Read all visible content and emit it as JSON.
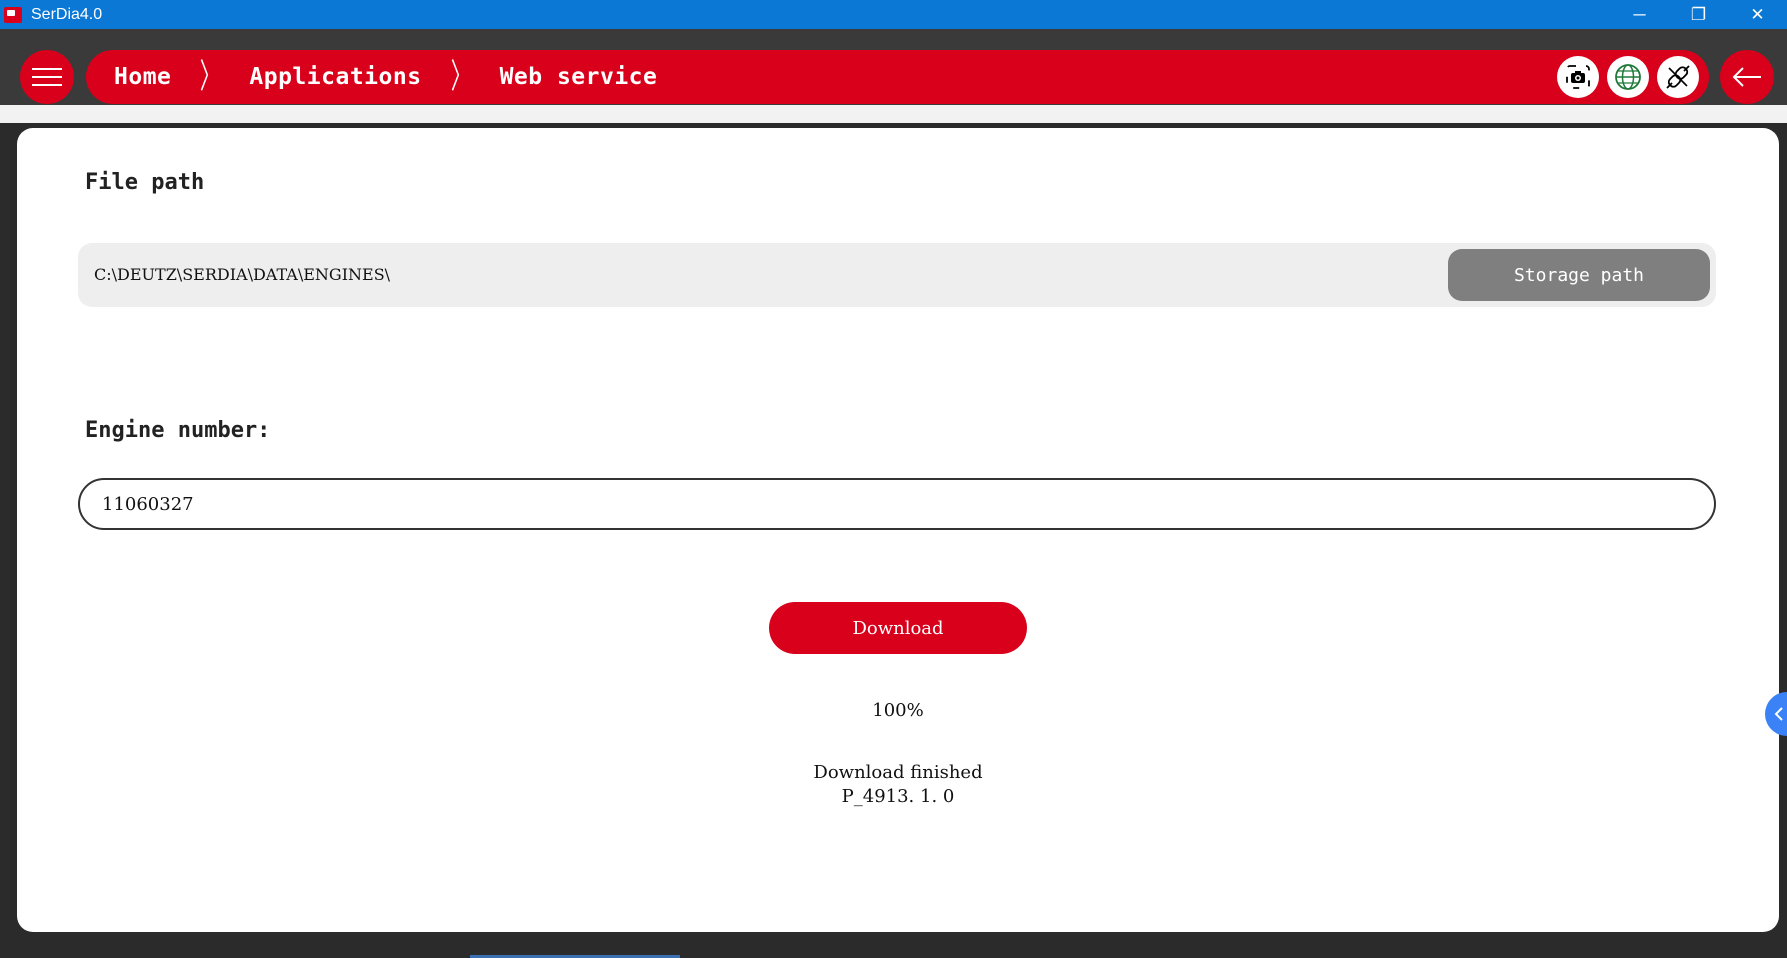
{
  "window": {
    "title": "SerDia4.0",
    "controls": {
      "minimize": "─",
      "maximize": "❐",
      "close": "✕"
    }
  },
  "nav": {
    "breadcrumbs": [
      "Home",
      "Applications",
      "Web service"
    ],
    "separator": "〉",
    "tools": [
      "camera-icon",
      "globe-icon",
      "disconnect-icon"
    ],
    "menu_icon": "hamburger-icon",
    "back_icon": "back-arrow-icon"
  },
  "main": {
    "file_path_label": "File path",
    "file_path_value": "C:\\DEUTZ\\SERDIA\\DATA\\ENGINES\\",
    "storage_button": "Storage path",
    "engine_label": "Engine number:",
    "engine_value": "11060327",
    "download_button": "Download",
    "progress": "100%",
    "status_line1": "Download finished",
    "status_line2": "P_4913. 1. 0"
  },
  "colors": {
    "accent": "#d8001b",
    "titlebar": "#0a78d4",
    "gray_button": "#7f7f7f",
    "side_tab": "#3b82f6"
  }
}
